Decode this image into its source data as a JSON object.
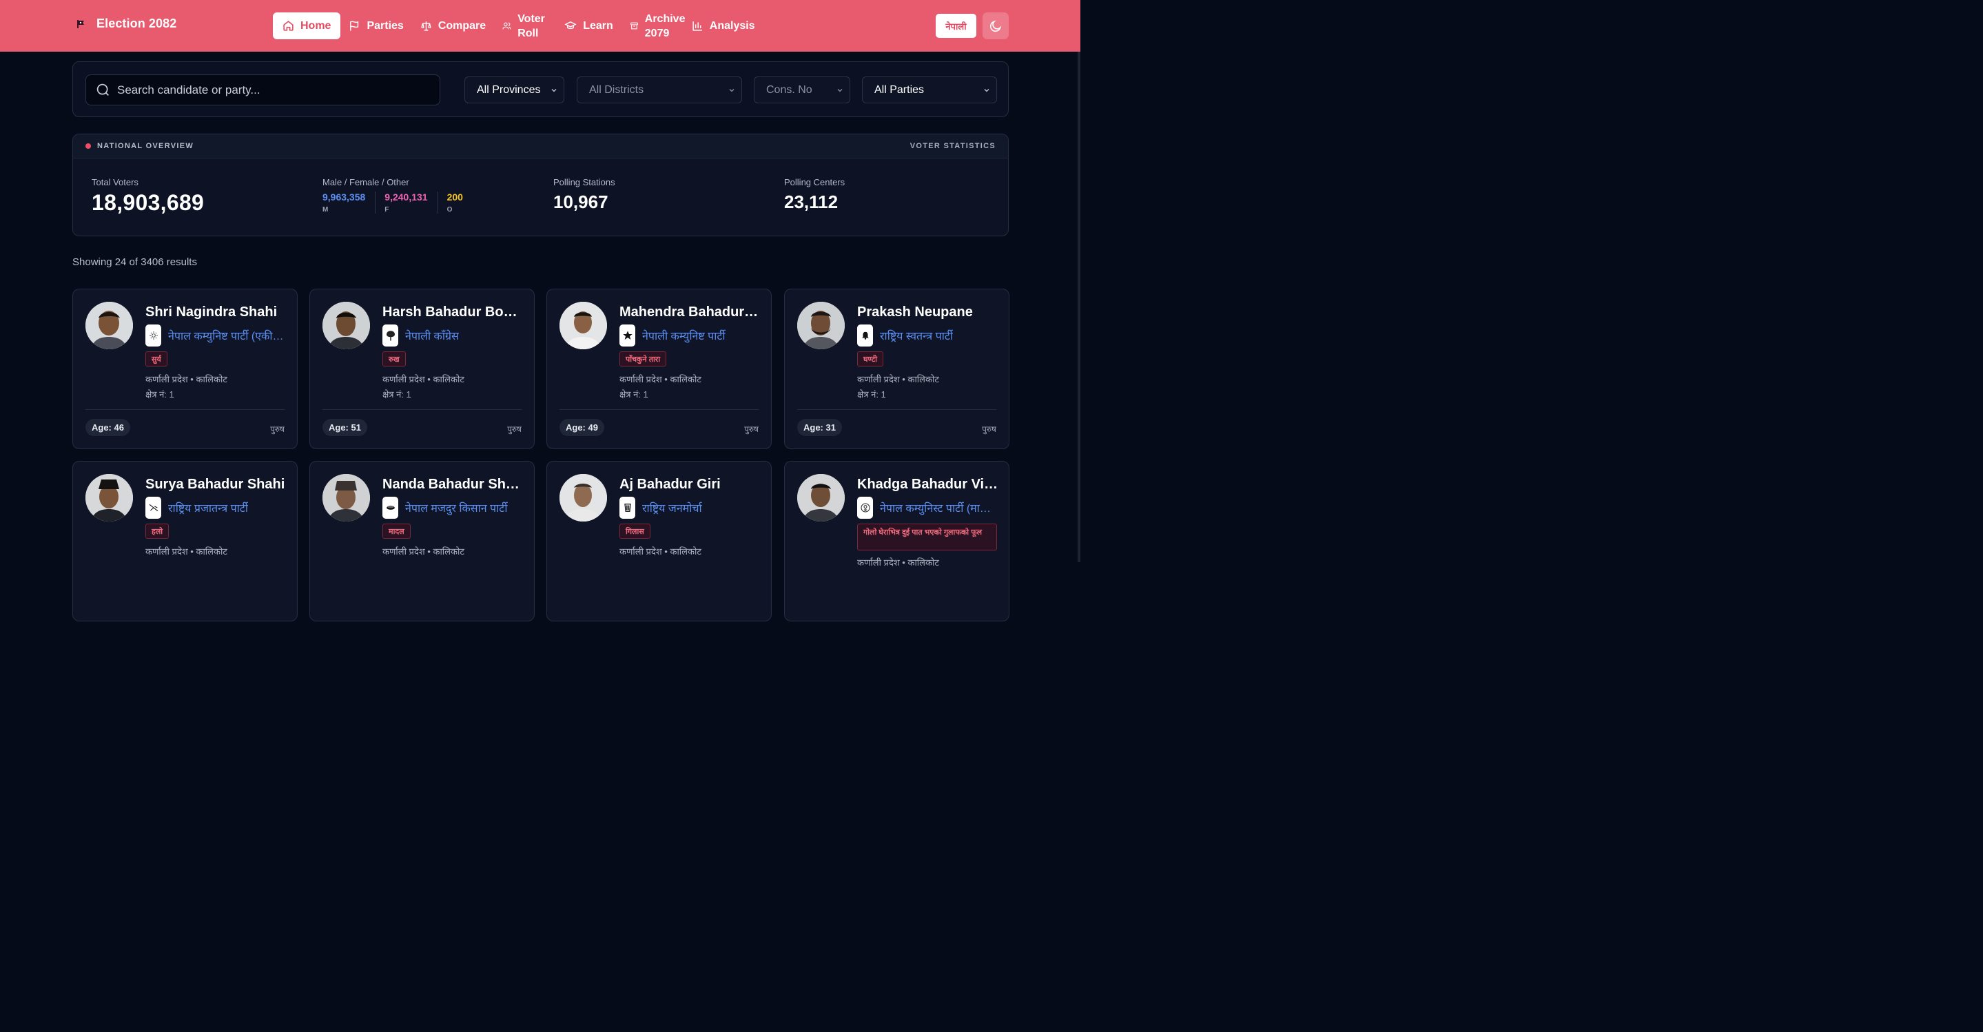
{
  "header": {
    "brand": "Election 2082",
    "nav": [
      {
        "label": "Home",
        "icon": "home-icon"
      },
      {
        "label": "Parties",
        "icon": "flag-icon"
      },
      {
        "label": "Compare",
        "icon": "scale-icon"
      },
      {
        "label": "Voter Roll",
        "icon": "users-icon"
      },
      {
        "label": "Learn",
        "icon": "graduation-cap-icon"
      },
      {
        "label": "Archive 2079",
        "icon": "archive-icon"
      },
      {
        "label": "Analysis",
        "icon": "bar-chart-icon"
      }
    ],
    "lang": "नेपाली"
  },
  "filters": {
    "search_placeholder": "Search candidate or party...",
    "province": "All Provinces",
    "district": "All Districts",
    "cons": "Cons. No",
    "party": "All Parties"
  },
  "overview": {
    "title": "NATIONAL OVERVIEW",
    "right": "VOTER STATISTICS",
    "total_label": "Total Voters",
    "total": "18,903,689",
    "gender_label": "Male / Female / Other",
    "male": "9,963,358",
    "male_l": "M",
    "female": "9,240,131",
    "female_l": "F",
    "other": "200",
    "other_l": "O",
    "stations_label": "Polling Stations",
    "stations": "10,967",
    "centers_label": "Polling Centers",
    "centers": "23,112"
  },
  "results_text": "Showing 24 of 3406 results",
  "colors": {
    "accent": "#e85a6e",
    "male": "#5b8ff3",
    "female": "#f062b1",
    "other": "#f5c518"
  },
  "cards": [
    {
      "name": "Shri Nagindra Shahi",
      "party": "नेपाल कम्युनिष्ट पार्टी (एकीकृत मार्क्सवादी लेनिनवादी)",
      "symbol": "सुर्य",
      "symbol_icon": "sun-icon",
      "loc": "कर्णाली प्रदेश • कालिकोट",
      "cons": "क्षेत्र नं: 1",
      "age": "Age: 46",
      "gender": "पुरुष"
    },
    {
      "name": "Harsh Bahadur Bomb",
      "party": "नेपाली काँग्रेस",
      "symbol": "रुख",
      "symbol_icon": "tree-icon",
      "loc": "कर्णाली प्रदेश • कालिकोट",
      "cons": "क्षेत्र नं: 1",
      "age": "Age: 51",
      "gender": "पुरुष"
    },
    {
      "name": "Mahendra Bahadur Shahi",
      "party": "नेपाली कम्युनिष्ट पार्टी",
      "symbol": "पाँचकुने तारा",
      "symbol_icon": "star-icon",
      "loc": "कर्णाली प्रदेश • कालिकोट",
      "cons": "क्षेत्र नं: 1",
      "age": "Age: 49",
      "gender": "पुरुष"
    },
    {
      "name": "Prakash Neupane",
      "party": "राष्ट्रिय स्वतन्त्र पार्टी",
      "symbol": "घण्टी",
      "symbol_icon": "bell-icon",
      "loc": "कर्णाली प्रदेश • कालिकोट",
      "cons": "क्षेत्र नं: 1",
      "age": "Age: 31",
      "gender": "पुरुष"
    },
    {
      "name": "Surya Bahadur Shahi",
      "party": "राष्ट्रिय प्रजातन्त्र पार्टी",
      "symbol": "हलो",
      "symbol_icon": "plough-icon",
      "loc": "कर्णाली प्रदेश • कालिकोट"
    },
    {
      "name": "Nanda Bahadur Shahi",
      "party": "नेपाल मजदुर किसान पार्टी",
      "symbol": "मादल",
      "symbol_icon": "drum-icon",
      "loc": "कर्णाली प्रदेश • कालिकोट"
    },
    {
      "name": "Aj Bahadur Giri",
      "party": "राष्ट्रिय जनमोर्चा",
      "symbol": "गिलास",
      "symbol_icon": "glass-icon",
      "loc": "कर्णाली प्रदेश • कालिकोट"
    },
    {
      "name": "Khadga Bahadur Vishwakarma",
      "party": "नेपाल कम्युनिस्ट पार्टी (माओवादी)",
      "symbol": "गोलो घेराभित्र दुई पात भएको गुलाफको फूल",
      "symbol_icon": "rose-icon",
      "loc": "कर्णाली प्रदेश • कालिकोट"
    }
  ]
}
